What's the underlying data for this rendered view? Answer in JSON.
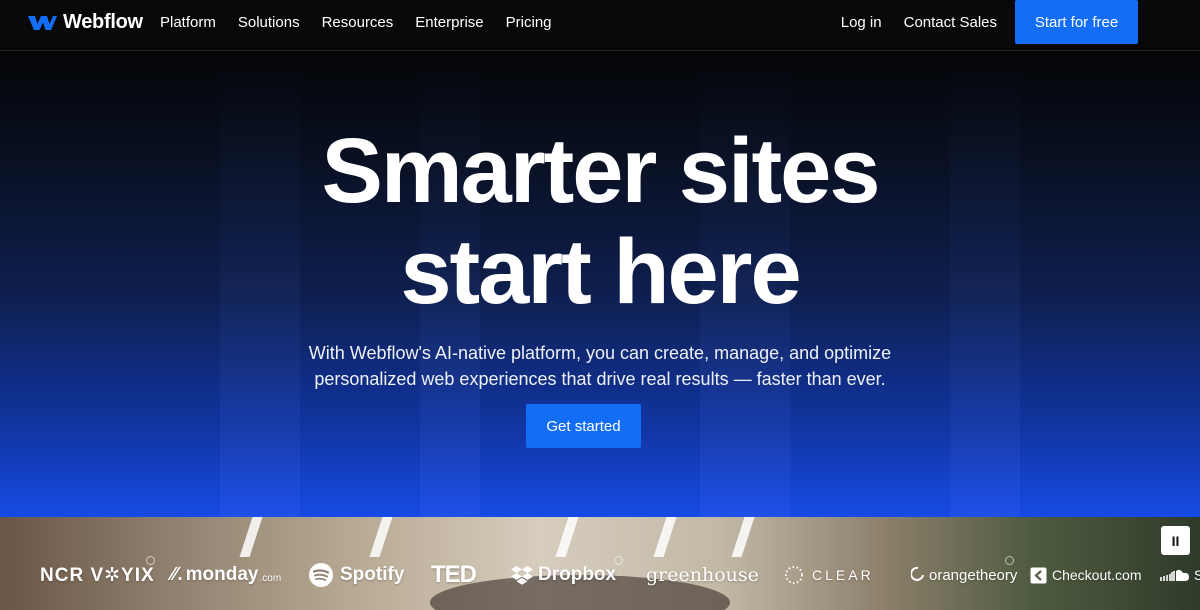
{
  "nav": {
    "logo_text": "Webflow",
    "links": [
      "Platform",
      "Solutions",
      "Resources",
      "Enterprise",
      "Pricing"
    ],
    "login": "Log in",
    "contact": "Contact Sales",
    "cta": "Start for free"
  },
  "hero": {
    "headline_line1": "Smarter sites",
    "headline_line2": "start here",
    "subtitle_line1": "With Webflow's AI-native platform, you can create, manage, and optimize",
    "subtitle_line2": "personalized web experiences that drive real results — faster than ever.",
    "cta": "Get started"
  },
  "logos": {
    "ncr": "NCR V✲YIX",
    "monday": "monday",
    "monday_suffix": ".com",
    "spotify": "Spotify",
    "ted": "TED",
    "dropbox": "Dropbox",
    "greenhouse": "greenhouse",
    "clear": "CLEAR",
    "orangetheory": "orangetheory",
    "checkout": "Checkout.com",
    "last": "S"
  },
  "controls": {
    "pause": "II"
  },
  "colors": {
    "accent": "#146ef5",
    "nav_bg": "#080808"
  }
}
